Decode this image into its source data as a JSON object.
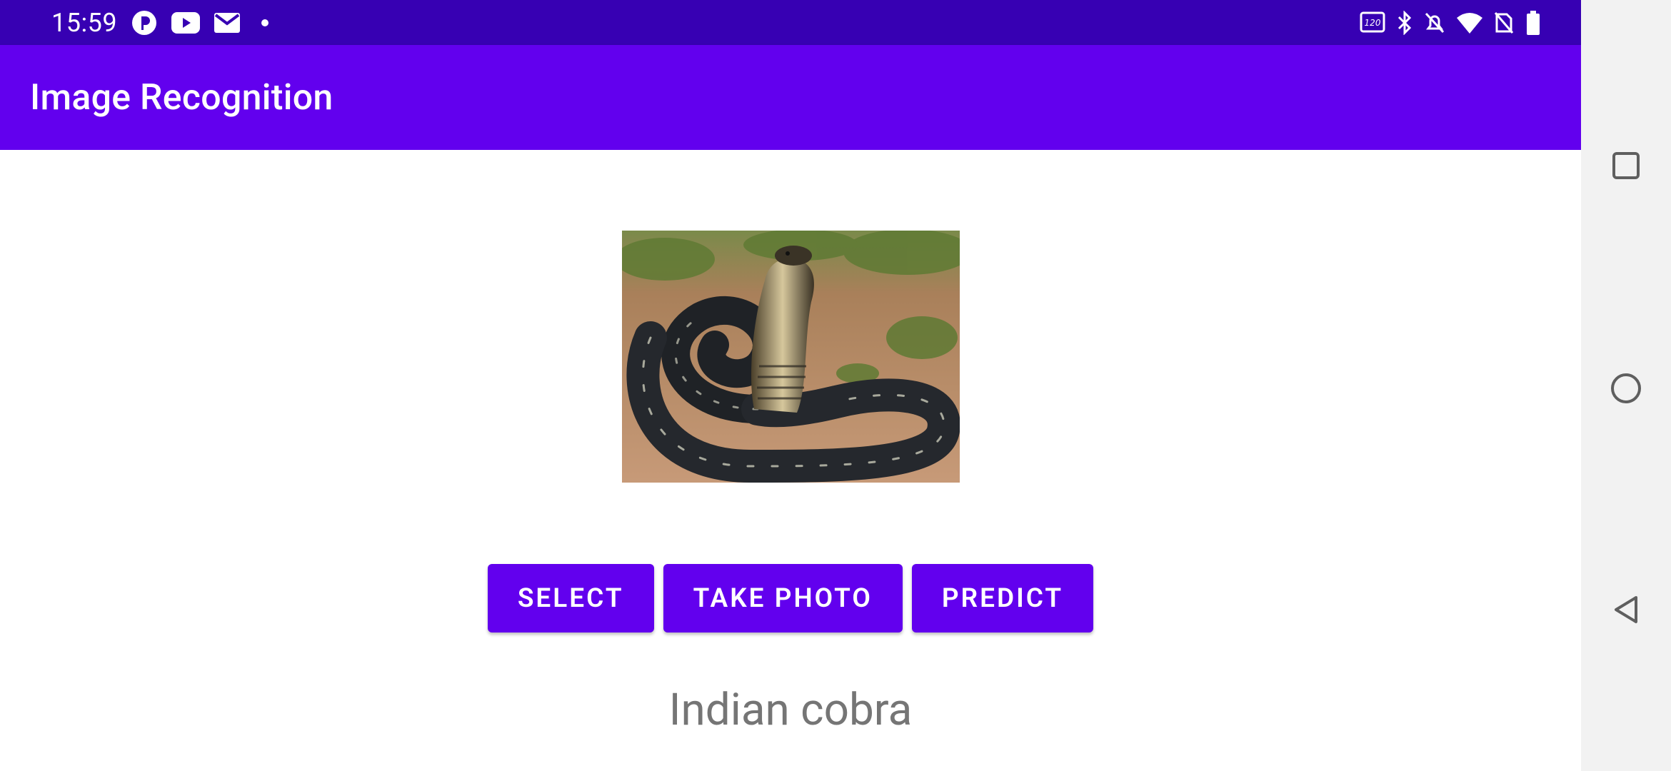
{
  "status_bar": {
    "time": "15:59",
    "left_icons": [
      "perplexity-icon",
      "youtube-icon",
      "gmail-icon",
      "notification-dot-icon"
    ],
    "right_icons": [
      "refresh-rate-120hz-icon",
      "bluetooth-icon",
      "notifications-off-icon",
      "wifi-icon",
      "no-sim-icon",
      "battery-icon"
    ]
  },
  "app_bar": {
    "title": "Image Recognition"
  },
  "preview": {
    "image_subject": "cobra-snake-photo"
  },
  "buttons": {
    "select": "SELECT",
    "take_photo": "TAKE PHOTO",
    "predict": "PREDICT"
  },
  "result": {
    "label": "Indian cobra"
  },
  "colors": {
    "status_bar": "#3700b3",
    "primary": "#6200ee",
    "result_text": "#757575",
    "nav_bg": "#f2f2f2"
  },
  "nav_bar": {
    "items": [
      "recents-square-icon",
      "home-circle-icon",
      "back-triangle-icon"
    ]
  }
}
